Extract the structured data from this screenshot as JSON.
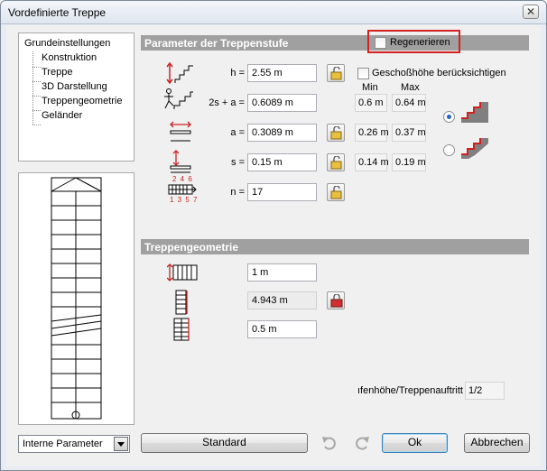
{
  "window": {
    "title": "Vordefinierte Treppe",
    "close_glyph": "✕"
  },
  "tree": {
    "root": "Grundeinstellungen",
    "children": [
      "Konstruktion",
      "Treppe",
      "3D Darstellung",
      "Treppengeometrie",
      "Geländer"
    ]
  },
  "params": {
    "header": "Parameter der Treppenstufe",
    "regenerate_label": "Regenerieren",
    "floor_height_label": "Geschoßhöhe berücksichtigen",
    "min_label": "Min",
    "max_label": "Max",
    "h_label": "h =",
    "h_value": "2.55 m",
    "stride_label": "2s + a =",
    "stride_value": "0.6089 m",
    "a_label": "a =",
    "a_value": "0.3089 m",
    "a_min": "0.26 m",
    "a_max": "0.37 m",
    "stride_min": "0.6 m",
    "stride_max": "0.64 m",
    "s_label": "s =",
    "s_value": "0.15 m",
    "s_min": "0.14 m",
    "s_max": "0.19 m",
    "n_label": "n =",
    "n_value": "17",
    "step_icon_top": "2 4 6",
    "step_icon_bottom": "1 3 5 7"
  },
  "geometry": {
    "header": "Treppengeometrie",
    "width_value": "1 m",
    "length_value": "4.943 m",
    "landing_value": "0.5 m",
    "ratio_label": "ıfenhöhe/Treppenauftritt",
    "ratio_value": "1/2"
  },
  "footer": {
    "select_value": "Interne Parameter",
    "standard_label": "Standard",
    "ok_label": "Ok",
    "cancel_label": "Abbrechen"
  },
  "colors": {
    "section_header": "#a0a0a0",
    "highlight": "#d42020",
    "icon_red": "#cc2222"
  }
}
